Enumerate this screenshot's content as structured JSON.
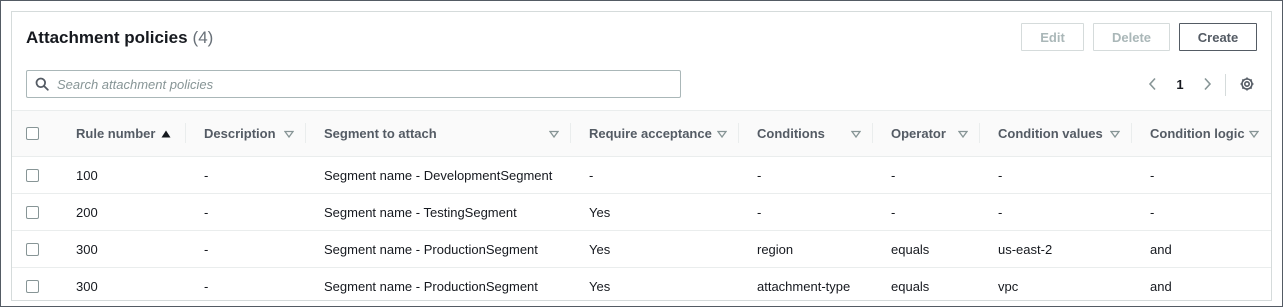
{
  "header": {
    "title": "Attachment policies",
    "count": "(4)"
  },
  "actions": {
    "edit": "Edit",
    "delete": "Delete",
    "create": "Create"
  },
  "search": {
    "placeholder": "Search attachment policies",
    "value": ""
  },
  "pagination": {
    "current_page": "1"
  },
  "table": {
    "columns": [
      "Rule number",
      "Description",
      "Segment to attach",
      "Require acceptance",
      "Conditions",
      "Operator",
      "Condition values",
      "Condition logic"
    ],
    "sorted_column": "Rule number",
    "rows": [
      [
        "100",
        "-",
        "Segment name - DevelopmentSegment",
        "-",
        "-",
        "-",
        "-",
        "-"
      ],
      [
        "200",
        "-",
        "Segment name - TestingSegment",
        "Yes",
        "-",
        "-",
        "-",
        "-"
      ],
      [
        "300",
        "-",
        "Segment name - ProductionSegment",
        "Yes",
        "region",
        "equals",
        "us-east-2",
        "and"
      ],
      [
        "300",
        "-",
        "Segment name - ProductionSegment",
        "Yes",
        "attachment-type",
        "equals",
        "vpc",
        "and"
      ]
    ]
  },
  "colors": {
    "text_primary": "#16191f",
    "text_secondary": "#545b64",
    "disabled": "#aab7b8",
    "border": "#d5dbdb"
  }
}
